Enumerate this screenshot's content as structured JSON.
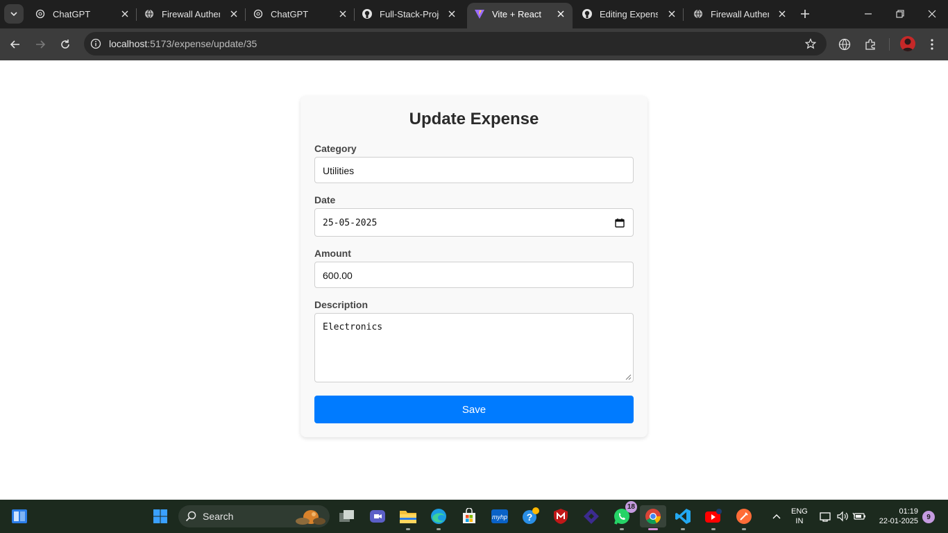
{
  "browser": {
    "tabs": [
      {
        "title": "ChatGPT",
        "icon": "chatgpt-icon",
        "active": false
      },
      {
        "title": "Firewall Authentication",
        "icon": "globe-icon",
        "active": false
      },
      {
        "title": "ChatGPT",
        "icon": "chatgpt-icon",
        "active": false
      },
      {
        "title": "Full-Stack-Project",
        "icon": "github-icon",
        "active": false
      },
      {
        "title": "Vite + React",
        "icon": "vite-icon",
        "active": true
      },
      {
        "title": "Editing Expense",
        "icon": "github-icon",
        "active": false
      },
      {
        "title": "Firewall Authentication",
        "icon": "globe-icon",
        "active": false
      }
    ],
    "url_host": "localhost",
    "url_path": ":5173/expense/update/35"
  },
  "form": {
    "heading": "Update Expense",
    "category_label": "Category",
    "category_value": "Utilities",
    "date_label": "Date",
    "date_value": "25-05-2025",
    "amount_label": "Amount",
    "amount_value": "600.00",
    "description_label": "Description",
    "description_value": "Electronics",
    "save_label": "Save",
    "accent_color": "#007bff"
  },
  "taskbar": {
    "search_label": "Search",
    "whatsapp_badge": "18",
    "language_line1": "ENG",
    "language_line2": "IN",
    "time": "01:19",
    "date": "22-01-2025",
    "notification_count": "9"
  }
}
